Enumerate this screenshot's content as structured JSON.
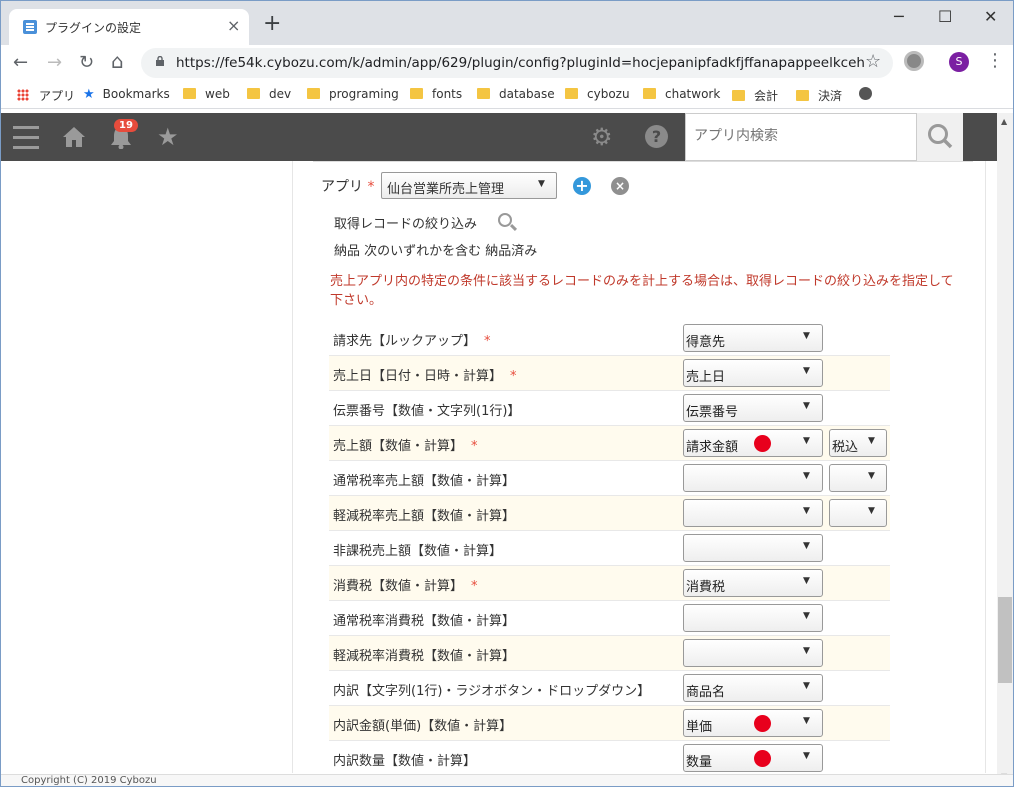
{
  "browser": {
    "tab_title": "プラグインの設定",
    "tab_close": "×",
    "new_tab": "+",
    "min": "─",
    "max": "☐",
    "close": "✕",
    "back": "←",
    "forward": "→",
    "reload": "↻",
    "home": "⌂",
    "url": "https://fe54k.cybozu.com/k/admin/app/629/plugin/config?pluginId=hocjepanipfadkfjffanapappeelkceh",
    "bookmark_star": "☆",
    "profile_initial": "S",
    "menu": "⋮"
  },
  "bookmarks": [
    {
      "label": "アプリ",
      "icon": "apps-grid-icon"
    },
    {
      "label": "Bookmarks",
      "icon": "star-icon"
    },
    {
      "label": "web",
      "icon": "folder-icon"
    },
    {
      "label": "dev",
      "icon": "folder-icon"
    },
    {
      "label": "programing",
      "icon": "folder-icon"
    },
    {
      "label": "fonts",
      "icon": "folder-icon"
    },
    {
      "label": "database",
      "icon": "folder-icon"
    },
    {
      "label": "cybozu",
      "icon": "folder-icon"
    },
    {
      "label": "chatwork",
      "icon": "folder-icon"
    },
    {
      "label": "会計",
      "icon": "folder-icon"
    },
    {
      "label": "決済",
      "icon": "folder-icon"
    }
  ],
  "header": {
    "notification_count": "19",
    "search_placeholder": "アプリ内検索",
    "star_glyph": "★",
    "gear_glyph": "⚙",
    "help_glyph": "?"
  },
  "config": {
    "app_label": "アプリ",
    "required_mark": "*",
    "app_value": "仙台営業所売上管理",
    "plus": "+",
    "remove": "×",
    "filter_label": "取得レコードの絞り込み",
    "filter_condition": "納品 次のいずれかを含む 納品済み",
    "notice": "売上アプリ内の特定の条件に該当するレコードのみを計上する場合は、取得レコードの絞り込みを指定して下さい。",
    "arrow": "▼"
  },
  "rows": [
    {
      "label": "請求先【ルックアップ】",
      "required": "*",
      "value": "得意先",
      "red_dot": false,
      "tax": null
    },
    {
      "label": "売上日【日付・日時・計算】",
      "required": "*",
      "value": "売上日",
      "red_dot": false,
      "tax": null
    },
    {
      "label": "伝票番号【数値・文字列(1行)】",
      "required": "",
      "value": "伝票番号",
      "red_dot": false,
      "tax": null
    },
    {
      "label": "売上額【数値・計算】",
      "required": "*",
      "value": "請求金額",
      "red_dot": true,
      "tax": "税込"
    },
    {
      "label": "通常税率売上額【数値・計算】",
      "required": "",
      "value": "",
      "red_dot": false,
      "tax": ""
    },
    {
      "label": "軽減税率売上額【数値・計算】",
      "required": "",
      "value": "",
      "red_dot": false,
      "tax": ""
    },
    {
      "label": "非課税売上額【数値・計算】",
      "required": "",
      "value": "",
      "red_dot": false,
      "tax": null
    },
    {
      "label": "消費税【数値・計算】",
      "required": "*",
      "value": "消費税",
      "red_dot": false,
      "tax": null
    },
    {
      "label": "通常税率消費税【数値・計算】",
      "required": "",
      "value": "",
      "red_dot": false,
      "tax": null
    },
    {
      "label": "軽減税率消費税【数値・計算】",
      "required": "",
      "value": "",
      "red_dot": false,
      "tax": null
    },
    {
      "label": "内訳【文字列(1行)・ラジオボタン・ドロップダウン】",
      "required": "",
      "value": "商品名",
      "red_dot": false,
      "tax": null
    },
    {
      "label": "内訳金額(単価)【数値・計算】",
      "required": "",
      "value": "単価",
      "red_dot": true,
      "tax": null
    },
    {
      "label": "内訳数量【数値・計算】",
      "required": "",
      "value": "数量",
      "red_dot": true,
      "tax": null
    }
  ],
  "footer": {
    "copyright": "Copyright (C) 2019 Cybozu"
  },
  "colors": {
    "header_bg": "#4b4b4b",
    "required": "#e74c3c",
    "notice": "#c0392b",
    "alt_row": "#fffbee",
    "red_dot": "#e8001c"
  }
}
